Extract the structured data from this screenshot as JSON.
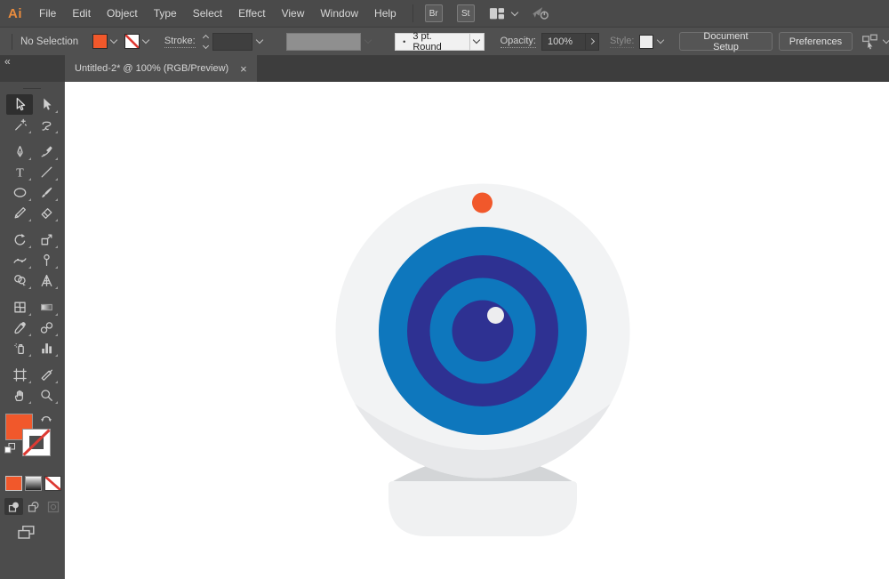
{
  "app_logo": "Ai",
  "menu_bar": {
    "items": [
      "File",
      "Edit",
      "Object",
      "Type",
      "Select",
      "Effect",
      "View",
      "Window",
      "Help"
    ],
    "br_label": "Br",
    "st_label": "St"
  },
  "control_bar": {
    "selection_status": "No Selection",
    "fill_color": "#f1582b",
    "stroke_label": "Stroke:",
    "brush_bullet": "•",
    "brush_name": "3 pt. Round",
    "opacity_label": "Opacity:",
    "opacity_value": "100%",
    "style_label": "Style:",
    "document_setup_label": "Document Setup",
    "preferences_label": "Preferences"
  },
  "tab_bar": {
    "collapse_glyph": "«",
    "active_tab": {
      "title": "Untitled-2* @ 100% (RGB/Preview)",
      "close_glyph": "×"
    }
  },
  "toolbar": {
    "selected_tool": "selection",
    "fill_color": "#f1582b",
    "tool_groups": [
      [
        [
          "selection",
          "direct-selection"
        ],
        [
          "magic-wand",
          "lasso"
        ]
      ],
      [
        [
          "pen",
          "curvature"
        ],
        [
          "type",
          "line-segment"
        ],
        [
          "ellipse",
          "paintbrush"
        ],
        [
          "shaper",
          "eraser"
        ]
      ],
      [
        [
          "rotate",
          "scale"
        ],
        [
          "width",
          "puppet-warp"
        ],
        [
          "shape-builder",
          "perspective-grid"
        ]
      ],
      [
        [
          "mesh",
          "gradient"
        ],
        [
          "eyedropper",
          "blend"
        ],
        [
          "symbol-sprayer",
          "column-graph"
        ]
      ],
      [
        [
          "artboard",
          "slice"
        ],
        [
          "hand",
          "zoom"
        ]
      ]
    ]
  },
  "canvas": {
    "artwork": "webcam illustration",
    "colors": {
      "body": "#f2f3f4",
      "body_shadow": "#e7e8ea",
      "stand_neck": "#d3d5d7",
      "stand_base": "#f0f1f2",
      "lens_blue": "#0e77bd",
      "lens_ring": "#2e3192",
      "pupil": "#2e3192",
      "highlight": "#ededef",
      "indicator_dot": "#f1582b"
    }
  },
  "theme": {
    "accent_orange": "#f1582b"
  }
}
